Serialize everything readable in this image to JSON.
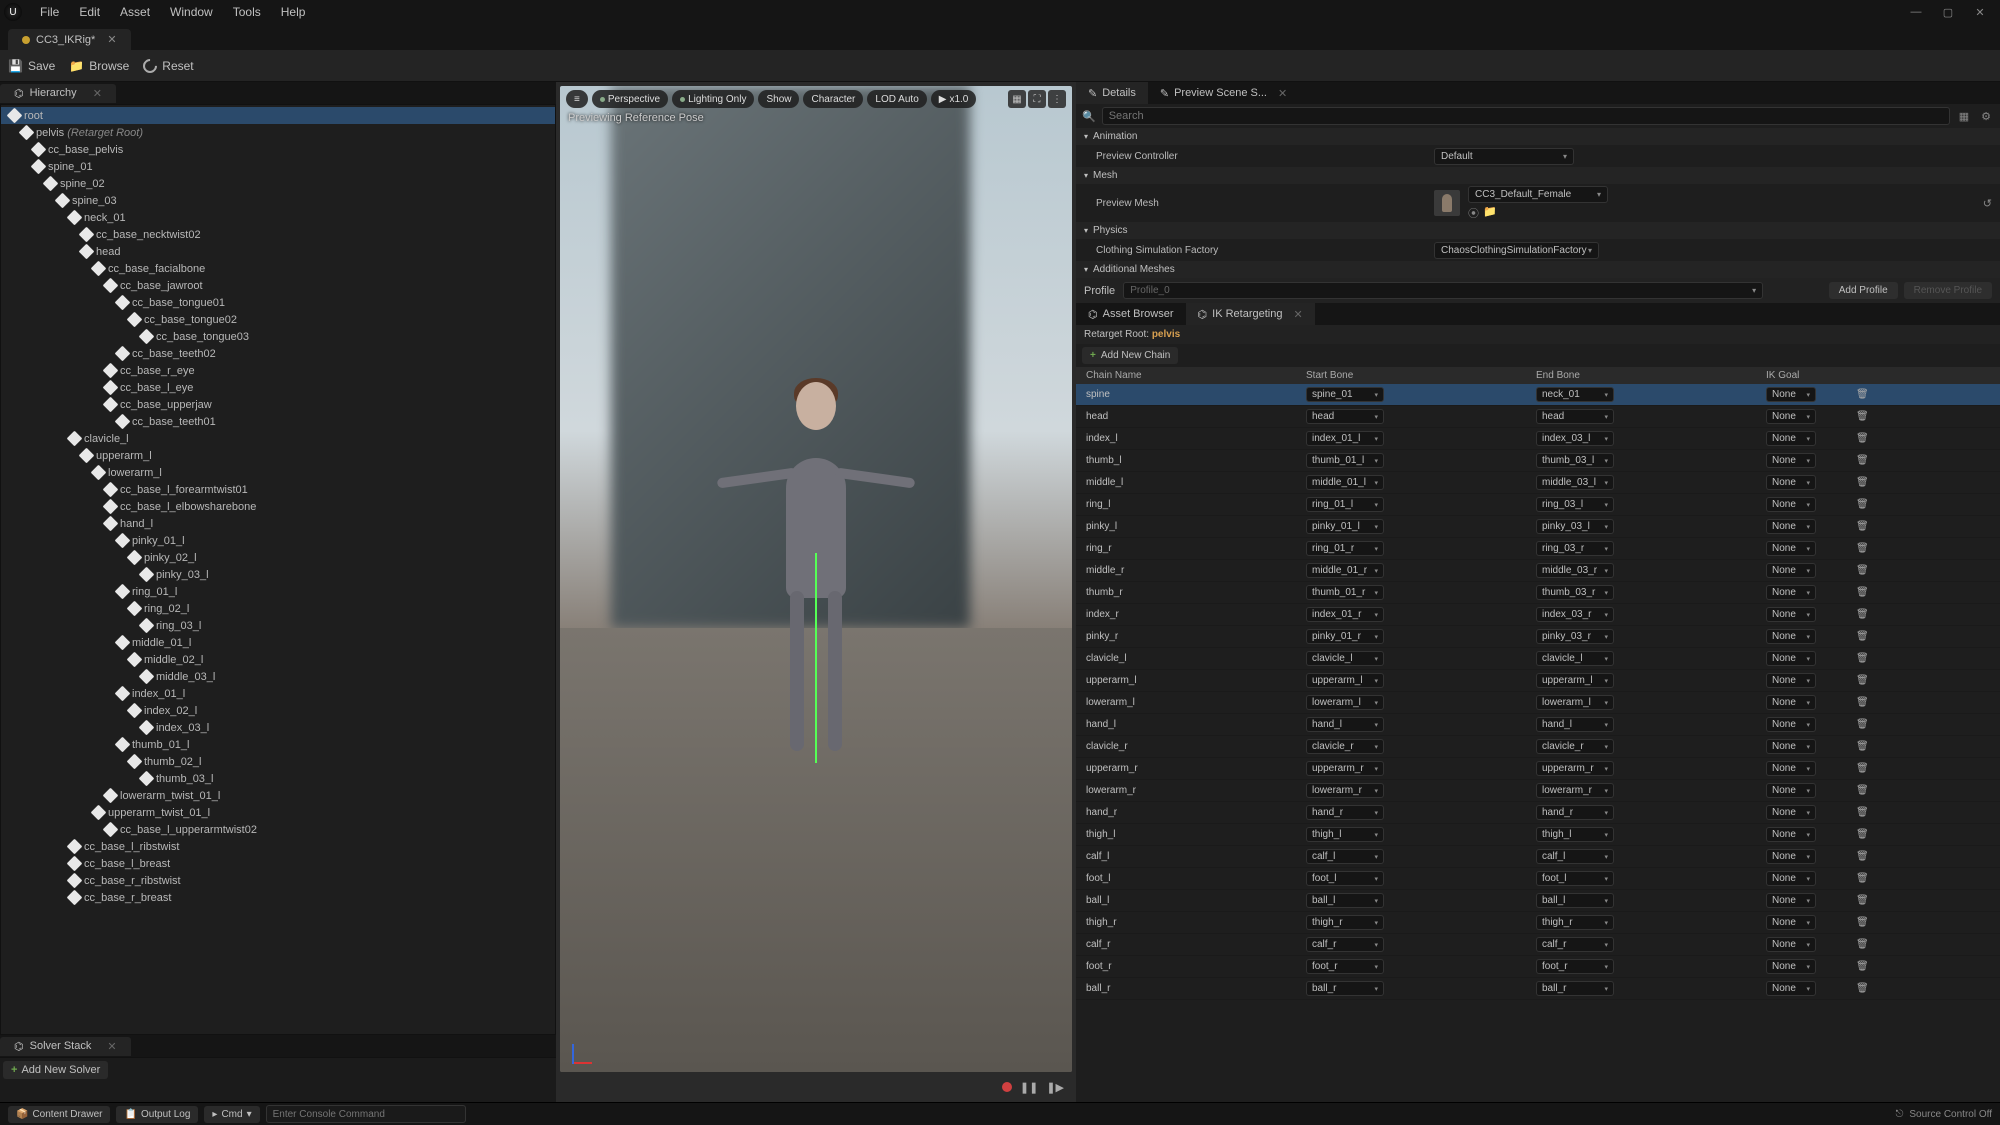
{
  "menus": [
    "File",
    "Edit",
    "Asset",
    "Window",
    "Tools",
    "Help"
  ],
  "file_tab": "CC3_IKRig*",
  "toolbar": {
    "save": "Save",
    "browse": "Browse",
    "reset": "Reset"
  },
  "panels": {
    "hierarchy": "Hierarchy",
    "solver": "Solver Stack",
    "add_solver": "Add New Solver",
    "details": "Details",
    "preview_scene": "Preview Scene S...",
    "asset_browser": "Asset Browser",
    "ik_retarget": "IK Retargeting"
  },
  "viewport": {
    "menu": "≡",
    "perspective": "Perspective",
    "lighting": "Lighting Only",
    "show": "Show",
    "character": "Character",
    "lod": "LOD Auto",
    "speed": "x1.0",
    "status": "Previewing Reference Pose"
  },
  "details": {
    "search_ph": "Search",
    "section_anim": "Animation",
    "preview_ctrl_lbl": "Preview Controller",
    "preview_ctrl_val": "Default",
    "section_mesh": "Mesh",
    "preview_mesh_lbl": "Preview Mesh",
    "preview_mesh_val": "CC3_Default_Female",
    "section_physics": "Physics",
    "clothing_lbl": "Clothing Simulation Factory",
    "clothing_val": "ChaosClothingSimulationFactory",
    "section_addmesh": "Additional Meshes",
    "profile_lbl": "Profile",
    "profile_val": "Profile_0",
    "add_profile": "Add Profile",
    "remove_profile": "Remove Profile"
  },
  "retarget": {
    "root_lbl": "Retarget Root:",
    "root_val": "pelvis",
    "add_chain": "Add New Chain",
    "hdr_name": "Chain Name",
    "hdr_start": "Start Bone",
    "hdr_end": "End Bone",
    "hdr_goal": "IK Goal"
  },
  "chains": [
    {
      "name": "spine",
      "start": "spine_01",
      "end": "neck_01",
      "goal": "None",
      "sel": true
    },
    {
      "name": "head",
      "start": "head",
      "end": "head",
      "goal": "None"
    },
    {
      "name": "index_l",
      "start": "index_01_l",
      "end": "index_03_l",
      "goal": "None"
    },
    {
      "name": "thumb_l",
      "start": "thumb_01_l",
      "end": "thumb_03_l",
      "goal": "None"
    },
    {
      "name": "middle_l",
      "start": "middle_01_l",
      "end": "middle_03_l",
      "goal": "None"
    },
    {
      "name": "ring_l",
      "start": "ring_01_l",
      "end": "ring_03_l",
      "goal": "None"
    },
    {
      "name": "pinky_l",
      "start": "pinky_01_l",
      "end": "pinky_03_l",
      "goal": "None"
    },
    {
      "name": "ring_r",
      "start": "ring_01_r",
      "end": "ring_03_r",
      "goal": "None"
    },
    {
      "name": "middle_r",
      "start": "middle_01_r",
      "end": "middle_03_r",
      "goal": "None"
    },
    {
      "name": "thumb_r",
      "start": "thumb_01_r",
      "end": "thumb_03_r",
      "goal": "None"
    },
    {
      "name": "index_r",
      "start": "index_01_r",
      "end": "index_03_r",
      "goal": "None"
    },
    {
      "name": "pinky_r",
      "start": "pinky_01_r",
      "end": "pinky_03_r",
      "goal": "None"
    },
    {
      "name": "clavicle_l",
      "start": "clavicle_l",
      "end": "clavicle_l",
      "goal": "None"
    },
    {
      "name": "upperarm_l",
      "start": "upperarm_l",
      "end": "upperarm_l",
      "goal": "None"
    },
    {
      "name": "lowerarm_l",
      "start": "lowerarm_l",
      "end": "lowerarm_l",
      "goal": "None"
    },
    {
      "name": "hand_l",
      "start": "hand_l",
      "end": "hand_l",
      "goal": "None"
    },
    {
      "name": "clavicle_r",
      "start": "clavicle_r",
      "end": "clavicle_r",
      "goal": "None"
    },
    {
      "name": "upperarm_r",
      "start": "upperarm_r",
      "end": "upperarm_r",
      "goal": "None"
    },
    {
      "name": "lowerarm_r",
      "start": "lowerarm_r",
      "end": "lowerarm_r",
      "goal": "None"
    },
    {
      "name": "hand_r",
      "start": "hand_r",
      "end": "hand_r",
      "goal": "None"
    },
    {
      "name": "thigh_l",
      "start": "thigh_l",
      "end": "thigh_l",
      "goal": "None"
    },
    {
      "name": "calf_l",
      "start": "calf_l",
      "end": "calf_l",
      "goal": "None"
    },
    {
      "name": "foot_l",
      "start": "foot_l",
      "end": "foot_l",
      "goal": "None"
    },
    {
      "name": "ball_l",
      "start": "ball_l",
      "end": "ball_l",
      "goal": "None"
    },
    {
      "name": "thigh_r",
      "start": "thigh_r",
      "end": "thigh_r",
      "goal": "None"
    },
    {
      "name": "calf_r",
      "start": "calf_r",
      "end": "calf_r",
      "goal": "None"
    },
    {
      "name": "foot_r",
      "start": "foot_r",
      "end": "foot_r",
      "goal": "None"
    },
    {
      "name": "ball_r",
      "start": "ball_r",
      "end": "ball_r",
      "goal": "None"
    }
  ],
  "hierarchy": [
    {
      "d": 0,
      "n": "root",
      "sel": true
    },
    {
      "d": 1,
      "n": "pelvis",
      "suffix": "(Retarget Root)"
    },
    {
      "d": 2,
      "n": "cc_base_pelvis"
    },
    {
      "d": 2,
      "n": "spine_01"
    },
    {
      "d": 3,
      "n": "spine_02"
    },
    {
      "d": 4,
      "n": "spine_03"
    },
    {
      "d": 5,
      "n": "neck_01"
    },
    {
      "d": 6,
      "n": "cc_base_necktwist02"
    },
    {
      "d": 6,
      "n": "head"
    },
    {
      "d": 7,
      "n": "cc_base_facialbone"
    },
    {
      "d": 8,
      "n": "cc_base_jawroot"
    },
    {
      "d": 9,
      "n": "cc_base_tongue01"
    },
    {
      "d": 10,
      "n": "cc_base_tongue02"
    },
    {
      "d": 11,
      "n": "cc_base_tongue03"
    },
    {
      "d": 9,
      "n": "cc_base_teeth02"
    },
    {
      "d": 8,
      "n": "cc_base_r_eye"
    },
    {
      "d": 8,
      "n": "cc_base_l_eye"
    },
    {
      "d": 8,
      "n": "cc_base_upperjaw"
    },
    {
      "d": 9,
      "n": "cc_base_teeth01"
    },
    {
      "d": 5,
      "n": "clavicle_l"
    },
    {
      "d": 6,
      "n": "upperarm_l"
    },
    {
      "d": 7,
      "n": "lowerarm_l"
    },
    {
      "d": 8,
      "n": "cc_base_l_forearmtwist01"
    },
    {
      "d": 8,
      "n": "cc_base_l_elbowsharebone"
    },
    {
      "d": 8,
      "n": "hand_l"
    },
    {
      "d": 9,
      "n": "pinky_01_l"
    },
    {
      "d": 10,
      "n": "pinky_02_l"
    },
    {
      "d": 11,
      "n": "pinky_03_l"
    },
    {
      "d": 9,
      "n": "ring_01_l"
    },
    {
      "d": 10,
      "n": "ring_02_l"
    },
    {
      "d": 11,
      "n": "ring_03_l"
    },
    {
      "d": 9,
      "n": "middle_01_l"
    },
    {
      "d": 10,
      "n": "middle_02_l"
    },
    {
      "d": 11,
      "n": "middle_03_l"
    },
    {
      "d": 9,
      "n": "index_01_l"
    },
    {
      "d": 10,
      "n": "index_02_l"
    },
    {
      "d": 11,
      "n": "index_03_l"
    },
    {
      "d": 9,
      "n": "thumb_01_l"
    },
    {
      "d": 10,
      "n": "thumb_02_l"
    },
    {
      "d": 11,
      "n": "thumb_03_l"
    },
    {
      "d": 8,
      "n": "lowerarm_twist_01_l"
    },
    {
      "d": 7,
      "n": "upperarm_twist_01_l"
    },
    {
      "d": 8,
      "n": "cc_base_l_upperarmtwist02"
    },
    {
      "d": 5,
      "n": "cc_base_l_ribstwist"
    },
    {
      "d": 5,
      "n": "cc_base_l_breast"
    },
    {
      "d": 5,
      "n": "cc_base_r_ribstwist"
    },
    {
      "d": 5,
      "n": "cc_base_r_breast"
    }
  ],
  "status": {
    "content_drawer": "Content Drawer",
    "output_log": "Output Log",
    "cmd": "Cmd",
    "console_ph": "Enter Console Command",
    "source_ctrl": "Source Control Off"
  }
}
